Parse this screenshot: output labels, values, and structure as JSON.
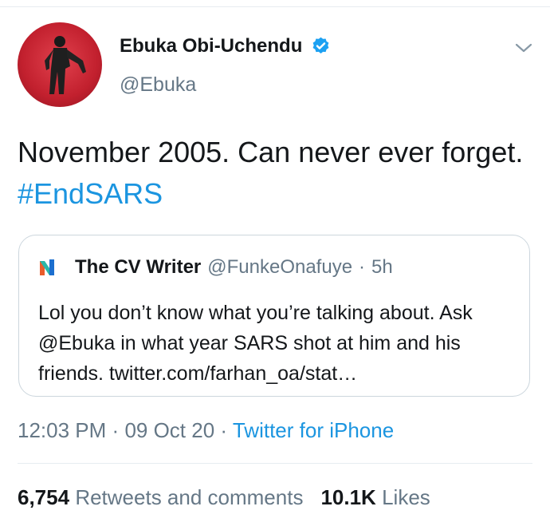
{
  "author": {
    "name": "Ebuka Obi-Uchendu",
    "handle": "@Ebuka",
    "avatar_icon": "profile-photo",
    "verified_icon": "verified-badge-icon"
  },
  "tweet": {
    "text": "November 2005. Can never ever forget.",
    "hashtag": "#EndSARS"
  },
  "quoted_tweet": {
    "author_name": "The CV Writer",
    "author_handle": "@FunkeOnafuye",
    "separator": "·",
    "age": "5h",
    "text": "Lol you don’t know what you’re talking about. Ask @Ebuka in what year SARS shot at him and his friends. twitter.com/farhan_oa/stat…"
  },
  "meta": {
    "time": "12:03 PM",
    "separator": "·",
    "date": "09 Oct 20",
    "source": "Twitter for iPhone"
  },
  "stats": {
    "retweets_count": "6,754",
    "retweets_label": "Retweets and comments",
    "likes_count": "10.1K",
    "likes_label": "Likes"
  },
  "colors": {
    "link": "#1b95e0",
    "muted": "#657786",
    "text": "#14171a",
    "avatar_bg": "#c2202e"
  }
}
